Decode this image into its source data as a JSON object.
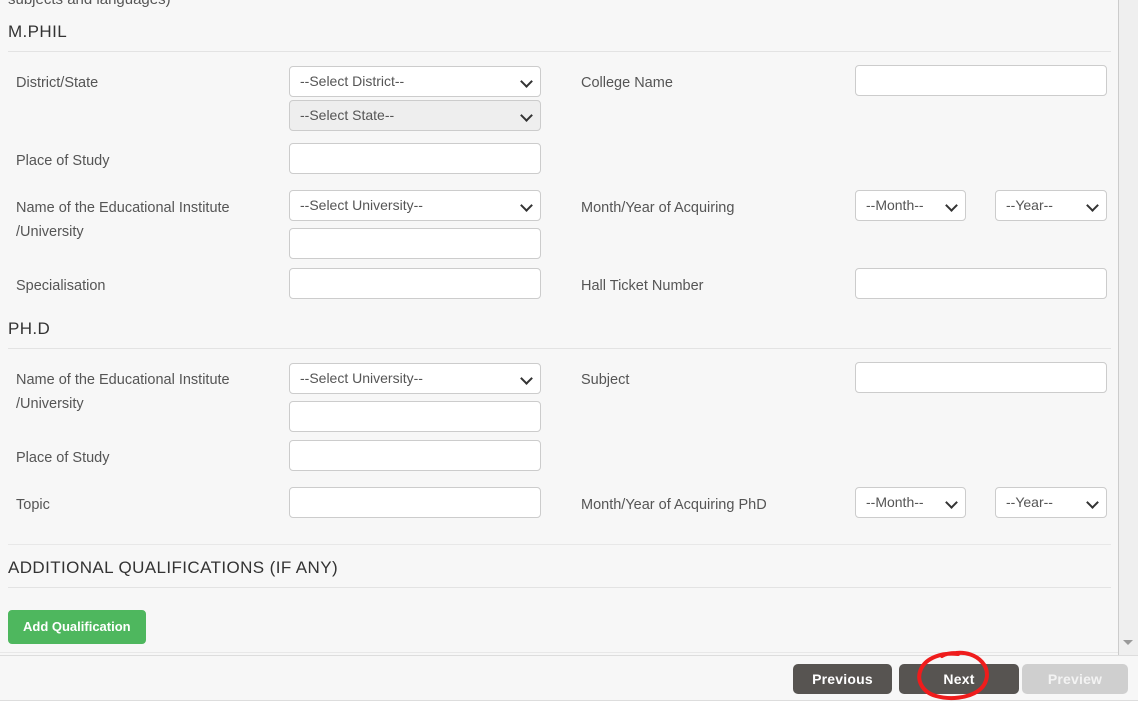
{
  "page": {
    "clipped_top_text": "subjects and languages)"
  },
  "sections": [
    {
      "id": "mphil",
      "title": "M.PHIL",
      "fields": [
        {
          "name": "district-state",
          "label": "District/State",
          "control": "select",
          "value": "--Select District--"
        },
        {
          "name": "state",
          "label": "",
          "control": "select",
          "value": "--Select State--",
          "disabled": true
        },
        {
          "name": "college-name",
          "label": "College Name",
          "control": "text",
          "value": ""
        },
        {
          "name": "place-of-study",
          "label": "Place of Study",
          "control": "text",
          "value": ""
        },
        {
          "name": "institute-university",
          "label": "Name of the Educational Institute /University",
          "control": "select",
          "value": "--Select University--"
        },
        {
          "name": "institute-university-text",
          "label": "",
          "control": "text",
          "value": ""
        },
        {
          "name": "month-of-acquiring",
          "label": "Month/Year of Acquiring",
          "control": "select",
          "value": "--Month--"
        },
        {
          "name": "year-of-acquiring",
          "label": "",
          "control": "select",
          "value": "--Year--"
        },
        {
          "name": "specialisation",
          "label": "Specialisation",
          "control": "text",
          "value": ""
        },
        {
          "name": "hall-ticket-number",
          "label": "Hall Ticket Number",
          "control": "text",
          "value": ""
        }
      ]
    },
    {
      "id": "phd",
      "title": "PH.D",
      "fields": [
        {
          "name": "institute-university",
          "label": "Name of the Educational Institute /University",
          "control": "select",
          "value": "--Select University--"
        },
        {
          "name": "institute-university-text",
          "label": "",
          "control": "text",
          "value": ""
        },
        {
          "name": "subject",
          "label": "Subject",
          "control": "text",
          "value": ""
        },
        {
          "name": "place-of-study",
          "label": "Place of Study",
          "control": "text",
          "value": ""
        },
        {
          "name": "topic",
          "label": "Topic",
          "control": "text",
          "value": ""
        },
        {
          "name": "month-of-acquiring-phd",
          "label": "Month/Year of Acquiring PhD",
          "control": "select",
          "value": "--Month--"
        },
        {
          "name": "year-of-acquiring-phd",
          "label": "",
          "control": "select",
          "value": "--Year--"
        }
      ]
    },
    {
      "id": "additional",
      "title": "ADDITIONAL QUALIFICATIONS (IF ANY)",
      "fields": []
    }
  ],
  "labels": {
    "mphil_title": "M.PHIL",
    "phd_title": "PH.D",
    "additional_title": "ADDITIONAL QUALIFICATIONS (IF ANY)",
    "district_state": "District/State",
    "college_name": "College Name",
    "place_of_study": "Place of Study",
    "institute_line1": "Name of the Educational Institute",
    "institute_line2": "/University",
    "month_year_acquiring": "Month/Year of Acquiring",
    "specialisation": "Specialisation",
    "hall_ticket_number": "Hall Ticket Number",
    "subject": "Subject",
    "topic": "Topic",
    "month_year_acquiring_phd": "Month/Year of Acquiring PhD"
  },
  "values": {
    "select_district": "--Select District--",
    "select_state": "--Select State--",
    "select_university": "--Select University--",
    "month": "--Month--",
    "year": "--Year--"
  },
  "buttons": {
    "add_qualification": "Add Qualification",
    "previous": "Previous",
    "next": "Next",
    "preview": "Preview"
  },
  "annotation": {
    "type": "hand-drawn-ellipse",
    "target": "Next",
    "color": "#ef1c1c"
  },
  "colors": {
    "page_background": "#efefef",
    "panel_background": "#f7f7f7",
    "green_button": "#4eb75e",
    "dark_button": "#575451",
    "disabled_button": "#cfcfcf",
    "annotation_red": "#ef1c1c",
    "label_text": "#555555"
  }
}
